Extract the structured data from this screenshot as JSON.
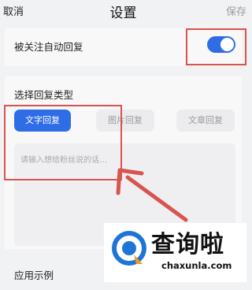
{
  "header": {
    "cancel_label": "取消",
    "title": "设置",
    "save_label": "保存"
  },
  "auto_reply": {
    "label": "被关注自动回复",
    "enabled": true
  },
  "reply_type": {
    "section_title": "选择回复类型",
    "options": [
      "文字回复",
      "图片回复",
      "文章回复"
    ],
    "selected": "文字回复"
  },
  "message_input": {
    "placeholder": "请输入想给粉丝说的话…"
  },
  "example": {
    "label": "应用示例"
  },
  "watermark": {
    "chinese": "查询啦",
    "domain": "chaxunla.com"
  },
  "colors": {
    "accent": "#2f6de6",
    "annotation": "#d9534f",
    "logo_blue": "#1f74d8",
    "logo_orange": "#f39a1c"
  }
}
